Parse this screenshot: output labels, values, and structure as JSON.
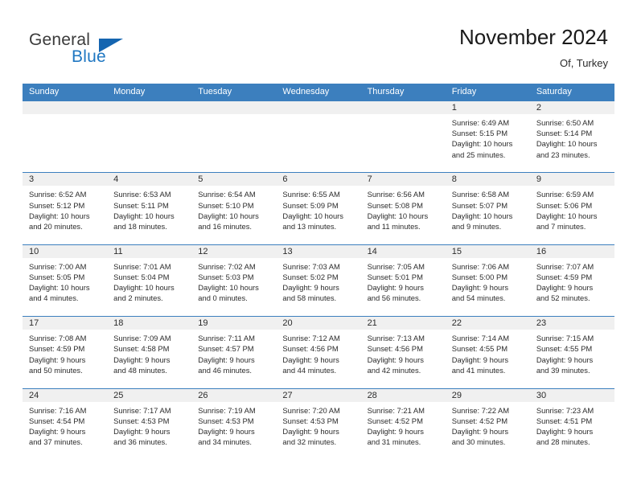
{
  "logo": {
    "word_one": "General",
    "word_two": "Blue",
    "accent_color": "#1565b0"
  },
  "header": {
    "title": "November 2024",
    "location": "Of, Turkey"
  },
  "theme": {
    "header_blue": "#3c7fbe",
    "band_gray": "#f0f0f0",
    "text": "#2b2b2b"
  },
  "calendar": {
    "weekday_headers": [
      "Sunday",
      "Monday",
      "Tuesday",
      "Wednesday",
      "Thursday",
      "Friday",
      "Saturday"
    ],
    "weeks": [
      [
        {
          "day": "",
          "empty": true
        },
        {
          "day": "",
          "empty": true
        },
        {
          "day": "",
          "empty": true
        },
        {
          "day": "",
          "empty": true
        },
        {
          "day": "",
          "empty": true
        },
        {
          "day": "1",
          "sunrise": "Sunrise: 6:49 AM",
          "sunset": "Sunset: 5:15 PM",
          "daylight_1": "Daylight: 10 hours",
          "daylight_2": "and 25 minutes."
        },
        {
          "day": "2",
          "sunrise": "Sunrise: 6:50 AM",
          "sunset": "Sunset: 5:14 PM",
          "daylight_1": "Daylight: 10 hours",
          "daylight_2": "and 23 minutes."
        }
      ],
      [
        {
          "day": "3",
          "sunrise": "Sunrise: 6:52 AM",
          "sunset": "Sunset: 5:12 PM",
          "daylight_1": "Daylight: 10 hours",
          "daylight_2": "and 20 minutes."
        },
        {
          "day": "4",
          "sunrise": "Sunrise: 6:53 AM",
          "sunset": "Sunset: 5:11 PM",
          "daylight_1": "Daylight: 10 hours",
          "daylight_2": "and 18 minutes."
        },
        {
          "day": "5",
          "sunrise": "Sunrise: 6:54 AM",
          "sunset": "Sunset: 5:10 PM",
          "daylight_1": "Daylight: 10 hours",
          "daylight_2": "and 16 minutes."
        },
        {
          "day": "6",
          "sunrise": "Sunrise: 6:55 AM",
          "sunset": "Sunset: 5:09 PM",
          "daylight_1": "Daylight: 10 hours",
          "daylight_2": "and 13 minutes."
        },
        {
          "day": "7",
          "sunrise": "Sunrise: 6:56 AM",
          "sunset": "Sunset: 5:08 PM",
          "daylight_1": "Daylight: 10 hours",
          "daylight_2": "and 11 minutes."
        },
        {
          "day": "8",
          "sunrise": "Sunrise: 6:58 AM",
          "sunset": "Sunset: 5:07 PM",
          "daylight_1": "Daylight: 10 hours",
          "daylight_2": "and 9 minutes."
        },
        {
          "day": "9",
          "sunrise": "Sunrise: 6:59 AM",
          "sunset": "Sunset: 5:06 PM",
          "daylight_1": "Daylight: 10 hours",
          "daylight_2": "and 7 minutes."
        }
      ],
      [
        {
          "day": "10",
          "sunrise": "Sunrise: 7:00 AM",
          "sunset": "Sunset: 5:05 PM",
          "daylight_1": "Daylight: 10 hours",
          "daylight_2": "and 4 minutes."
        },
        {
          "day": "11",
          "sunrise": "Sunrise: 7:01 AM",
          "sunset": "Sunset: 5:04 PM",
          "daylight_1": "Daylight: 10 hours",
          "daylight_2": "and 2 minutes."
        },
        {
          "day": "12",
          "sunrise": "Sunrise: 7:02 AM",
          "sunset": "Sunset: 5:03 PM",
          "daylight_1": "Daylight: 10 hours",
          "daylight_2": "and 0 minutes."
        },
        {
          "day": "13",
          "sunrise": "Sunrise: 7:03 AM",
          "sunset": "Sunset: 5:02 PM",
          "daylight_1": "Daylight: 9 hours",
          "daylight_2": "and 58 minutes."
        },
        {
          "day": "14",
          "sunrise": "Sunrise: 7:05 AM",
          "sunset": "Sunset: 5:01 PM",
          "daylight_1": "Daylight: 9 hours",
          "daylight_2": "and 56 minutes."
        },
        {
          "day": "15",
          "sunrise": "Sunrise: 7:06 AM",
          "sunset": "Sunset: 5:00 PM",
          "daylight_1": "Daylight: 9 hours",
          "daylight_2": "and 54 minutes."
        },
        {
          "day": "16",
          "sunrise": "Sunrise: 7:07 AM",
          "sunset": "Sunset: 4:59 PM",
          "daylight_1": "Daylight: 9 hours",
          "daylight_2": "and 52 minutes."
        }
      ],
      [
        {
          "day": "17",
          "sunrise": "Sunrise: 7:08 AM",
          "sunset": "Sunset: 4:59 PM",
          "daylight_1": "Daylight: 9 hours",
          "daylight_2": "and 50 minutes."
        },
        {
          "day": "18",
          "sunrise": "Sunrise: 7:09 AM",
          "sunset": "Sunset: 4:58 PM",
          "daylight_1": "Daylight: 9 hours",
          "daylight_2": "and 48 minutes."
        },
        {
          "day": "19",
          "sunrise": "Sunrise: 7:11 AM",
          "sunset": "Sunset: 4:57 PM",
          "daylight_1": "Daylight: 9 hours",
          "daylight_2": "and 46 minutes."
        },
        {
          "day": "20",
          "sunrise": "Sunrise: 7:12 AM",
          "sunset": "Sunset: 4:56 PM",
          "daylight_1": "Daylight: 9 hours",
          "daylight_2": "and 44 minutes."
        },
        {
          "day": "21",
          "sunrise": "Sunrise: 7:13 AM",
          "sunset": "Sunset: 4:56 PM",
          "daylight_1": "Daylight: 9 hours",
          "daylight_2": "and 42 minutes."
        },
        {
          "day": "22",
          "sunrise": "Sunrise: 7:14 AM",
          "sunset": "Sunset: 4:55 PM",
          "daylight_1": "Daylight: 9 hours",
          "daylight_2": "and 41 minutes."
        },
        {
          "day": "23",
          "sunrise": "Sunrise: 7:15 AM",
          "sunset": "Sunset: 4:55 PM",
          "daylight_1": "Daylight: 9 hours",
          "daylight_2": "and 39 minutes."
        }
      ],
      [
        {
          "day": "24",
          "sunrise": "Sunrise: 7:16 AM",
          "sunset": "Sunset: 4:54 PM",
          "daylight_1": "Daylight: 9 hours",
          "daylight_2": "and 37 minutes."
        },
        {
          "day": "25",
          "sunrise": "Sunrise: 7:17 AM",
          "sunset": "Sunset: 4:53 PM",
          "daylight_1": "Daylight: 9 hours",
          "daylight_2": "and 36 minutes."
        },
        {
          "day": "26",
          "sunrise": "Sunrise: 7:19 AM",
          "sunset": "Sunset: 4:53 PM",
          "daylight_1": "Daylight: 9 hours",
          "daylight_2": "and 34 minutes."
        },
        {
          "day": "27",
          "sunrise": "Sunrise: 7:20 AM",
          "sunset": "Sunset: 4:53 PM",
          "daylight_1": "Daylight: 9 hours",
          "daylight_2": "and 32 minutes."
        },
        {
          "day": "28",
          "sunrise": "Sunrise: 7:21 AM",
          "sunset": "Sunset: 4:52 PM",
          "daylight_1": "Daylight: 9 hours",
          "daylight_2": "and 31 minutes."
        },
        {
          "day": "29",
          "sunrise": "Sunrise: 7:22 AM",
          "sunset": "Sunset: 4:52 PM",
          "daylight_1": "Daylight: 9 hours",
          "daylight_2": "and 30 minutes."
        },
        {
          "day": "30",
          "sunrise": "Sunrise: 7:23 AM",
          "sunset": "Sunset: 4:51 PM",
          "daylight_1": "Daylight: 9 hours",
          "daylight_2": "and 28 minutes."
        }
      ]
    ]
  }
}
